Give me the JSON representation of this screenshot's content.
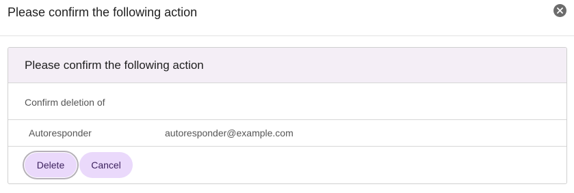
{
  "dialog": {
    "title": "Please confirm the following action",
    "close_icon": "close-icon"
  },
  "panel": {
    "title": "Please confirm the following action",
    "confirm_text": "Confirm deletion of",
    "items": [
      {
        "label": "Autoresponder",
        "value": "autoresponder@example.com"
      }
    ],
    "actions": {
      "delete_label": "Delete",
      "cancel_label": "Cancel"
    }
  },
  "colors": {
    "button_bg": "#ead9fb",
    "panel_header_bg": "#f4eef6",
    "close_icon_bg": "#6c6c6c"
  }
}
